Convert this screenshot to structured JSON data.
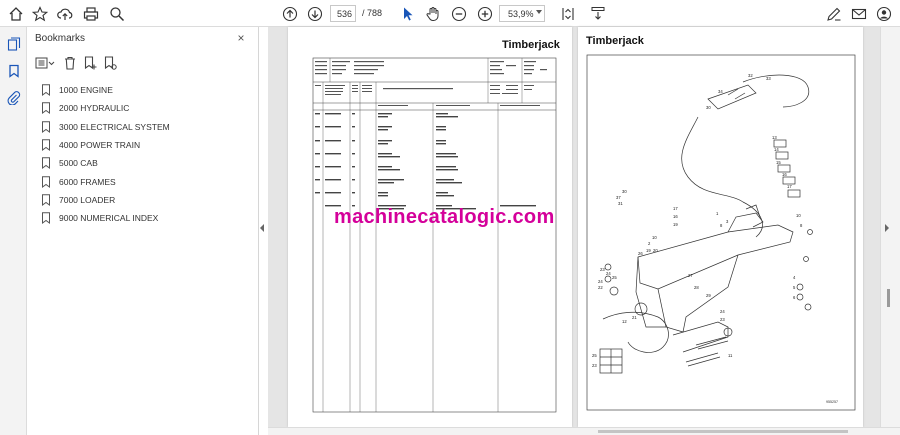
{
  "toolbar": {
    "current_page": "536",
    "total_pages": "/ 788",
    "zoom": "53,9%"
  },
  "bookmarks": {
    "title": "Bookmarks",
    "close": "×",
    "items": [
      {
        "label": "1000 ENGINE"
      },
      {
        "label": "2000 HYDRAULIC"
      },
      {
        "label": "3000 ELECTRICAL SYSTEM"
      },
      {
        "label": "4000 POWER TRAIN"
      },
      {
        "label": "5000 CAB"
      },
      {
        "label": "6000 FRAMES"
      },
      {
        "label": "7000 LOADER"
      },
      {
        "label": "9000 NUMERICAL INDEX"
      }
    ]
  },
  "document": {
    "left_page_brand": "Timberjack",
    "right_page_brand": "Timberjack",
    "watermark": "machinecatalogic.com",
    "left_table": {
      "rows": [
        {
          "pos": "25",
          "part": "1052827",
          "desc": "COLPPE / PLUG",
          "desc2": "PROPP / VERSCHLUSS"
        },
        {
          "pos": "26",
          "part": "1037438",
          "desc": "RENGAS / RING",
          "desc2": "RING / RING"
        },
        {
          "pos": "27",
          "part": "1037175",
          "desc": "RENGAS / RING",
          "desc2": "RING / RING"
        },
        {
          "pos": "28",
          "part": "1044300",
          "desc": "SUOJUS / PROTECTION",
          "desc2": "STANSKYDD / STOSSCHUTZ"
        },
        {
          "pos": "29",
          "part": "1044299",
          "desc": "SUOJUS / PROTECTION",
          "desc2": "STANSKYDD / STOSSCHUTZ"
        },
        {
          "pos": "30",
          "part": "1035082",
          "desc": "LUKKOMUTTERI / LOCK NUT",
          "desc2": "LÅSMUTTER / SICHERMUTTER"
        },
        {
          "pos": "31",
          "part": "1035566",
          "desc": "RUUVI / SCREW",
          "desc2": "SKRUV / SCHRAUBE"
        },
        {
          "pos": "",
          "part": "1032710",
          "desc": "LUKITUSRAUTA / LOCKING PLATE",
          "desc2": "LÅSJÄRN"
        }
      ]
    },
    "figure_ref": "955257"
  }
}
